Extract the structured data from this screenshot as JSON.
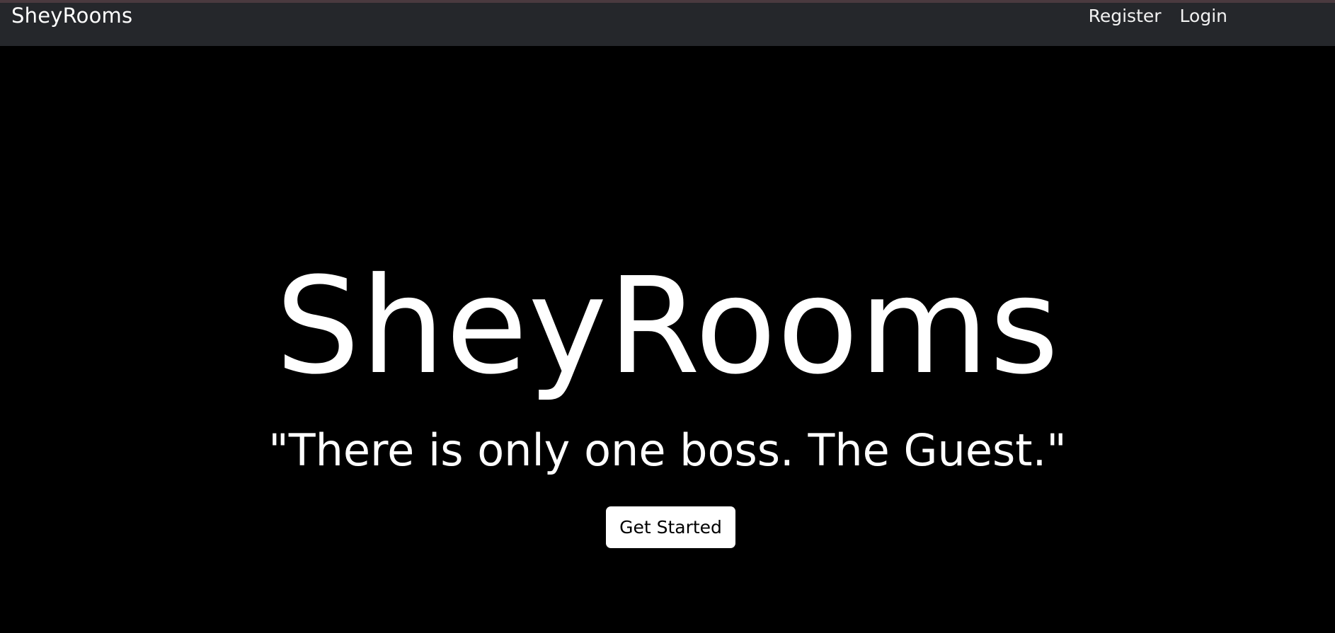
{
  "navbar": {
    "brand": "SheyRooms",
    "links": [
      {
        "label": "Register"
      },
      {
        "label": "Login"
      }
    ]
  },
  "hero": {
    "title": "SheyRooms",
    "quote": "\"There is only one boss. The Guest.\"",
    "cta_label": "Get Started"
  },
  "colors": {
    "navbar_bg": "#25272b",
    "page_bg": "#000000",
    "text": "#ffffff",
    "button_bg": "#ffffff",
    "button_text": "#000000"
  }
}
